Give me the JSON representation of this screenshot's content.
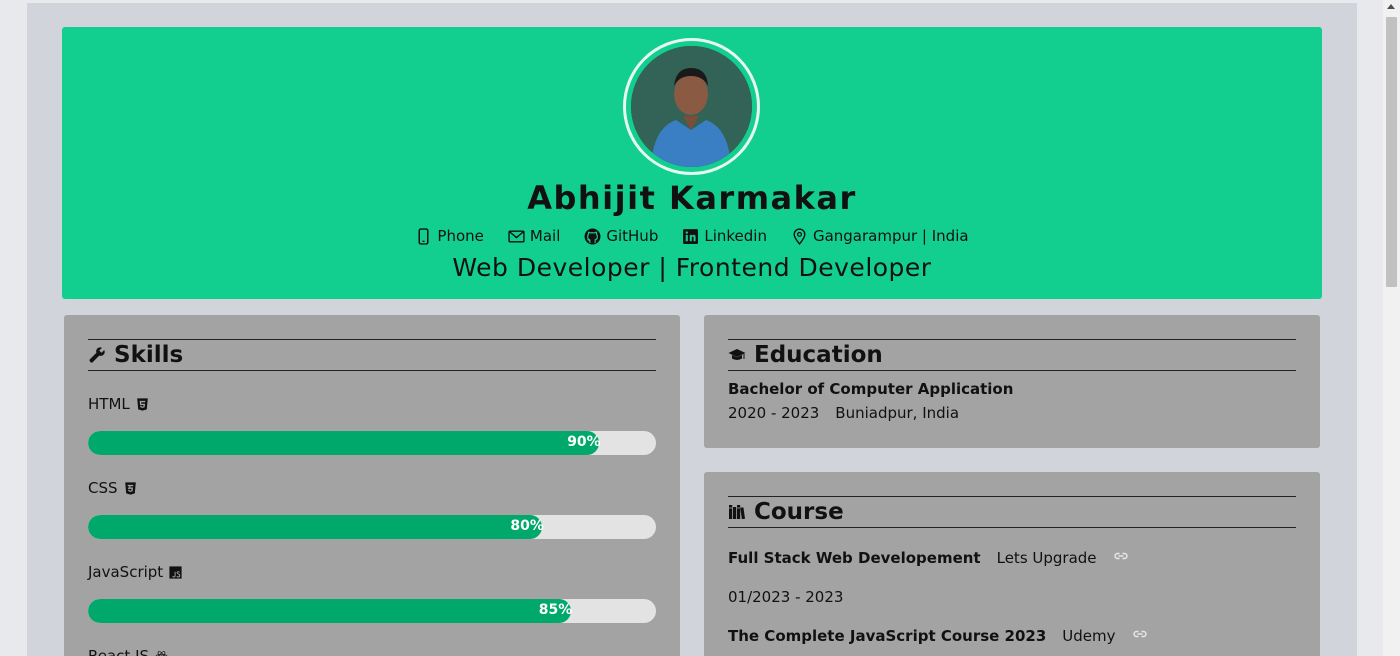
{
  "profile": {
    "name": "Abhijit Karmakar",
    "title": "Web Developer | Frontend Developer",
    "contacts": [
      {
        "label": "Phone",
        "icon": "phone-icon"
      },
      {
        "label": "Mail",
        "icon": "mail-icon"
      },
      {
        "label": "GitHub",
        "icon": "github-icon"
      },
      {
        "label": "Linkedin",
        "icon": "linkedin-icon"
      },
      {
        "label": "Gangarampur | India",
        "icon": "location-icon"
      }
    ]
  },
  "skills": {
    "heading": "Skills",
    "items": [
      {
        "label": "HTML",
        "percent": 90,
        "percent_label": "90%",
        "icon": "html5-icon"
      },
      {
        "label": "CSS",
        "percent": 80,
        "percent_label": "80%",
        "icon": "css3-icon"
      },
      {
        "label": "JavaScript",
        "percent": 85,
        "percent_label": "85%",
        "icon": "js-icon"
      },
      {
        "label": "React JS",
        "icon": "react-icon"
      }
    ]
  },
  "education": {
    "heading": "Education",
    "degree": "Bachelor of Computer Application",
    "years": "2020 - 2023",
    "location": "Buniadpur, India"
  },
  "course": {
    "heading": "Course",
    "items": [
      {
        "name": "Full Stack Web Developement",
        "provider": "Lets Upgrade",
        "dates": "01/2023 - 2023"
      },
      {
        "name": "The Complete JavaScript Course 2023",
        "provider": "Udemy"
      }
    ]
  },
  "colors": {
    "header_bg": "#13cf8f",
    "card_bg": "#a3a3a3",
    "bar_fill": "#00a86b",
    "bar_track": "#e3e3e3",
    "page_bg": "#d2d4dc"
  }
}
